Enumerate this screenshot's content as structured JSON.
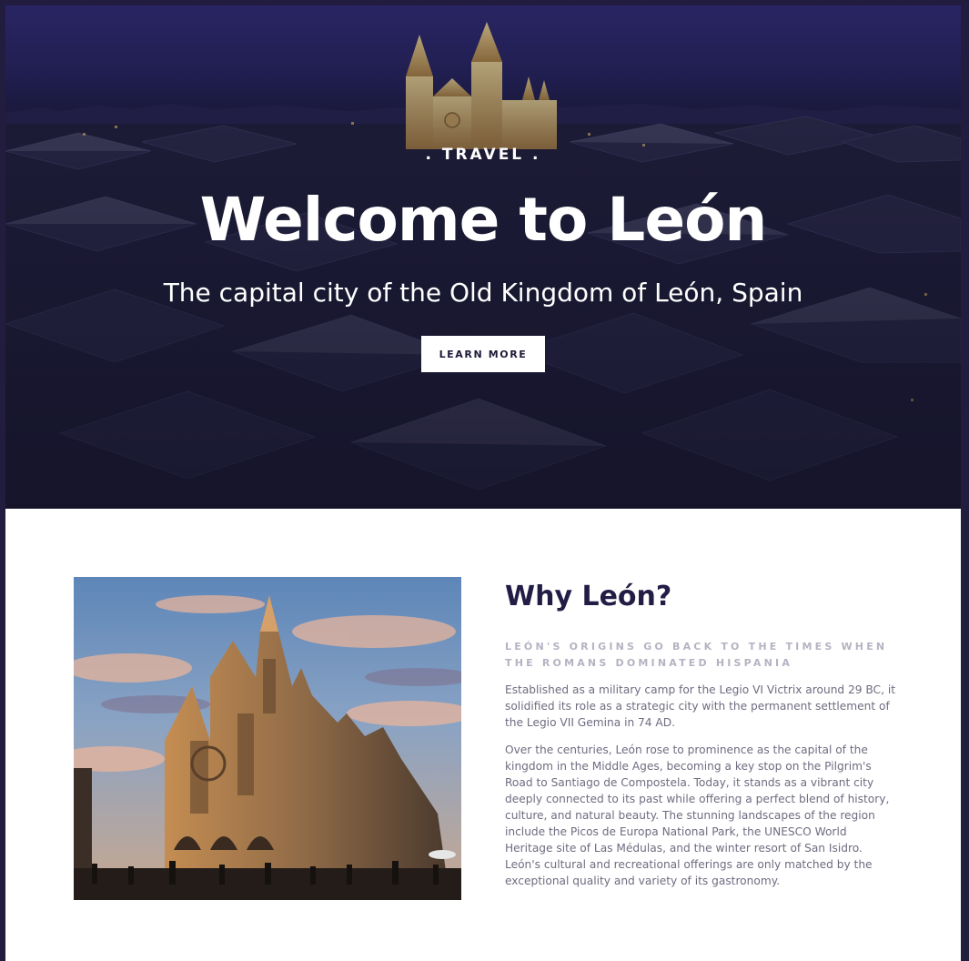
{
  "hero": {
    "eyebrow": ". TRAVEL .",
    "title": "Welcome to León",
    "subtitle": "The capital city of the Old Kingdom of León, Spain",
    "button_label": "LEARN MORE"
  },
  "why": {
    "title": "Why León?",
    "kicker": "LEÓN'S ORIGINS GO BACK TO THE TIMES WHEN THE ROMANS DOMINATED HISPANIA",
    "paragraphs": [
      "Established as a military camp for the Legio VI Victrix around 29 BC, it solidified its role as a strategic city with the permanent settlement of the Legio VII Gemina in 74 AD.",
      "Over the centuries, León rose to prominence as the capital of the kingdom in the Middle Ages, becoming a key stop on the Pilgrim's Road to Santiago de Compostela. Today, it stands as a vibrant city deeply connected to its past while offering a perfect blend of history, culture, and natural beauty. The stunning landscapes of the region include the Picos de Europa National Park, the UNESCO World Heritage site of Las Médulas, and the winter resort of San Isidro. León's cultural and recreational offerings are only matched by the exceptional quality and variety of its gastronomy."
    ]
  },
  "colors": {
    "page_border": "#221d3e",
    "title_navy": "#221d45",
    "kicker_gray": "#b5b3c2",
    "body_gray": "#6e6c80"
  }
}
